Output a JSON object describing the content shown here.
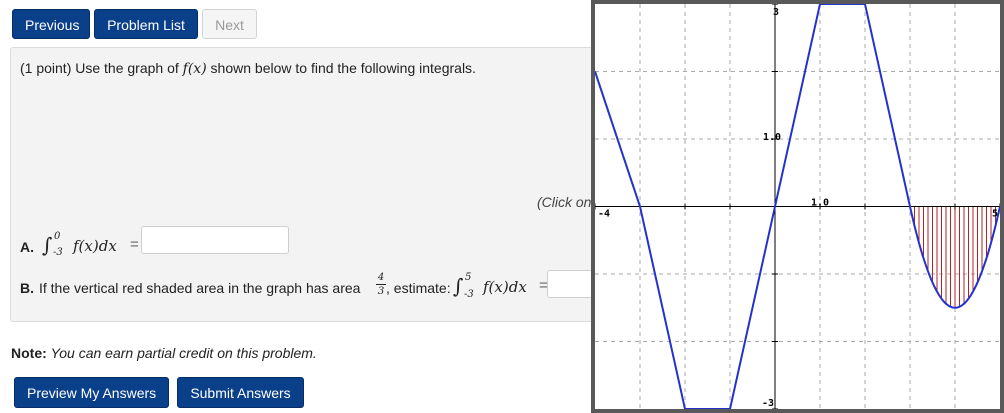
{
  "nav": {
    "previous_label": "Previous",
    "problem_list_label": "Problem List",
    "next_label": "Next"
  },
  "problem": {
    "intro_prefix": "(1 point) Use the graph of ",
    "intro_func": "f(x)",
    "intro_suffix": " shown below to find the following integrals.",
    "click_hint": "(Click on",
    "part_a": {
      "label": "A.",
      "lower": "-3",
      "upper": "0",
      "integrand": "f(x)dx",
      "equals": "=",
      "answer_value": ""
    },
    "part_b": {
      "label": "B.",
      "text_prefix": "If the vertical red shaded area in the graph has area",
      "area_num": "4",
      "area_den": "3",
      "text_mid": ", estimate:",
      "lower": "-3",
      "upper": "5",
      "integrand": "f(x)dx",
      "equals": "=",
      "answer_value": ""
    }
  },
  "note": {
    "label": "Note:",
    "text": "You can earn partial credit on this problem."
  },
  "actions": {
    "preview_label": "Preview My Answers",
    "submit_label": "Submit Answers"
  },
  "graph": {
    "curve_color": "#2233cc",
    "shade_color": "#b22222",
    "tick_labels": {
      "y_top": "3",
      "y_bottom": "-3",
      "x_left": "-4",
      "x_right": "5",
      "x_unit": "1.0",
      "y_unit": "1.0"
    }
  },
  "chart_data": {
    "type": "line",
    "title": "",
    "xlabel": "",
    "ylabel": "",
    "xlim": [
      -4,
      5
    ],
    "ylim": [
      -3,
      3
    ],
    "grid": true,
    "series": [
      {
        "x": [
          -4,
          -3,
          -2,
          -1,
          0,
          1,
          2,
          3,
          4,
          5
        ],
        "y": [
          2.0,
          0,
          -3.0,
          -3.0,
          0,
          3.0,
          3.0,
          0,
          -1.5,
          0
        ]
      }
    ],
    "shaded_region": {
      "x_from": 3,
      "x_to": 5,
      "area": 1.333
    }
  }
}
